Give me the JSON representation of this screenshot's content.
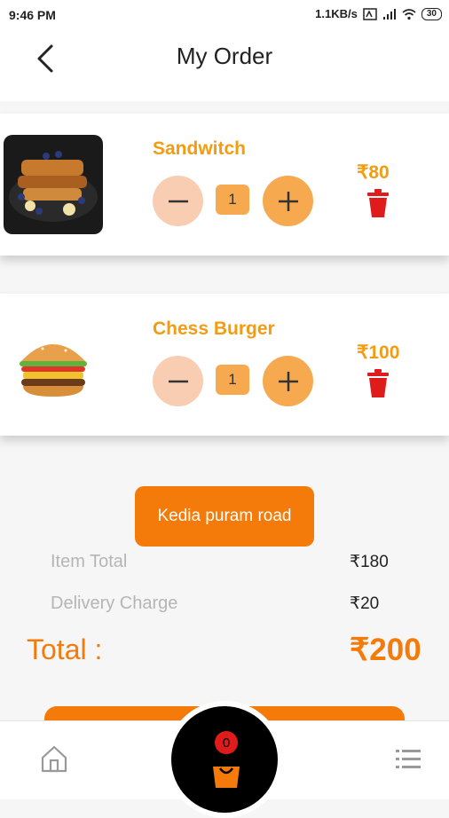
{
  "status_bar": {
    "time": "9:46 PM",
    "network_speed": "1.1KB/s",
    "battery": "30"
  },
  "header": {
    "title": "My Order"
  },
  "items": [
    {
      "name": "Sandwitch",
      "quantity": "1",
      "price": "₹80"
    },
    {
      "name": "Chess Burger",
      "quantity": "1",
      "price": "₹100"
    }
  ],
  "address_button": "Kedia puram road",
  "summary": {
    "item_total_label": "Item Total",
    "item_total_value": "₹180",
    "delivery_label": "Delivery Charge",
    "delivery_value": "₹20",
    "total_label": "Total :",
    "total_value": "₹200"
  },
  "bottom_nav": {
    "cart_count": "0"
  },
  "colors": {
    "accent": "#f47b0a",
    "price": "#f39c12",
    "minus_bg": "#f8cdb2",
    "plus_bg": "#f6a94f",
    "delete": "#e01b1b"
  },
  "icons": [
    "back-arrow-icon",
    "minus-icon",
    "plus-icon",
    "trash-icon",
    "home-icon",
    "list-icon",
    "shopping-bag-icon"
  ]
}
